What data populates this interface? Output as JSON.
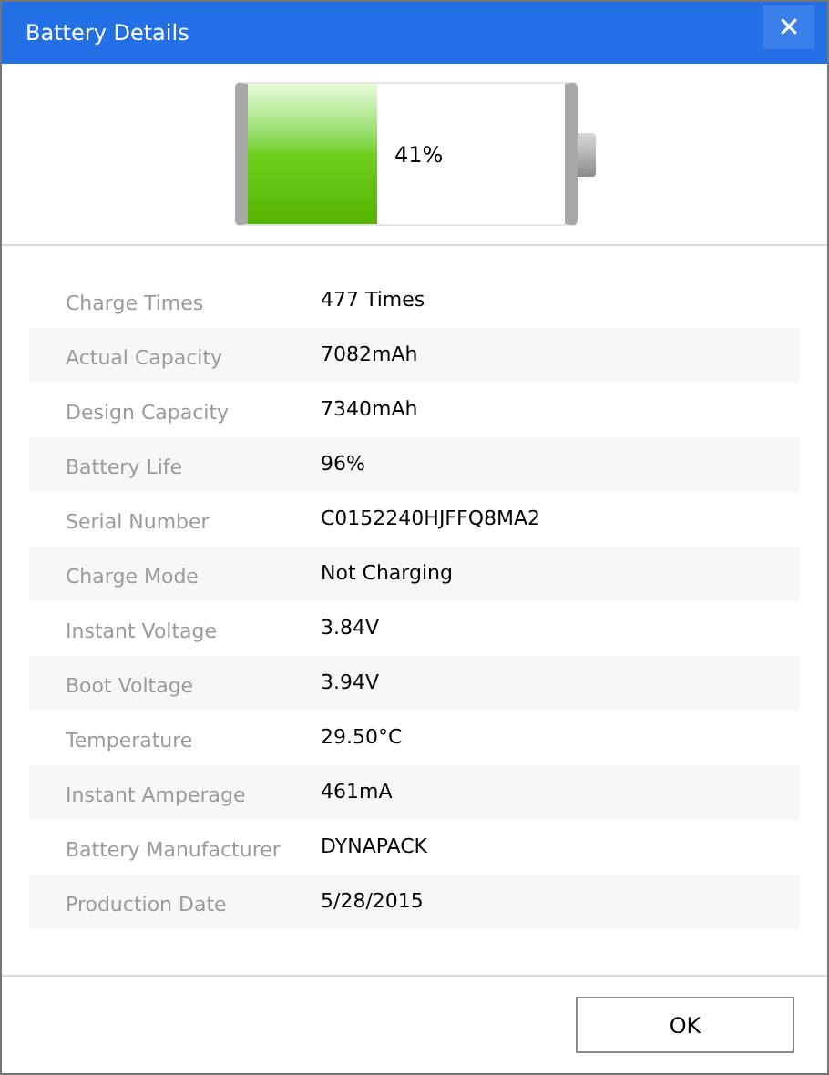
{
  "window": {
    "title": "Battery Details",
    "close": "✕"
  },
  "battery": {
    "reading": "41%"
  },
  "details": [
    {
      "label": "Charge Times",
      "value": "477 Times"
    },
    {
      "label": "Actual Capacity",
      "value": "7082mAh"
    },
    {
      "label": "Design Capacity",
      "value": "7340mAh"
    },
    {
      "label": "Battery Life",
      "value": "96%"
    },
    {
      "label": "Serial Number",
      "value": "C0152240HJFFQ8MA2"
    },
    {
      "label": "Charge Mode",
      "value": "Not Charging"
    },
    {
      "label": "Instant Voltage",
      "value": "3.84V"
    },
    {
      "label": "Boot Voltage",
      "value": "3.94V"
    },
    {
      "label": "Temperature",
      "value": "29.50°C"
    },
    {
      "label": "Instant Amperage",
      "value": "461mA"
    },
    {
      "label": "Battery Manufacturer",
      "value": "DYNAPACK"
    },
    {
      "label": "Production Date",
      "value": "5/28/2015"
    }
  ],
  "buttons": [
    "OK"
  ]
}
